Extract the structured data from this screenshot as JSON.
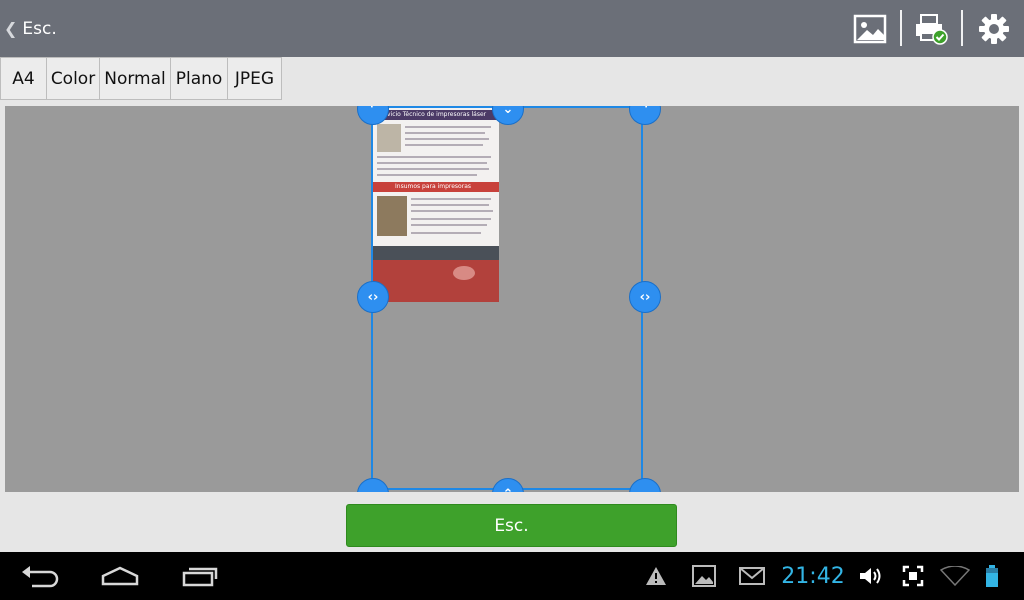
{
  "actionbar": {
    "back_label": "Esc.",
    "icons": [
      "image-icon",
      "print-check-icon",
      "settings-gear-icon"
    ]
  },
  "options": [
    "A4",
    "Color",
    "Normal",
    "Plano",
    "JPEG"
  ],
  "preview": {
    "doc_heading_1": "vicio Técnico de impresoras láser",
    "doc_heading_2": "Insumos para impresoras"
  },
  "bottom": {
    "button_label": "Esc."
  },
  "status": {
    "time": "21:42"
  },
  "colors": {
    "accent_blue": "#33b5e5",
    "button_green": "#3ea12b",
    "handle_blue": "#2e8ff0"
  }
}
